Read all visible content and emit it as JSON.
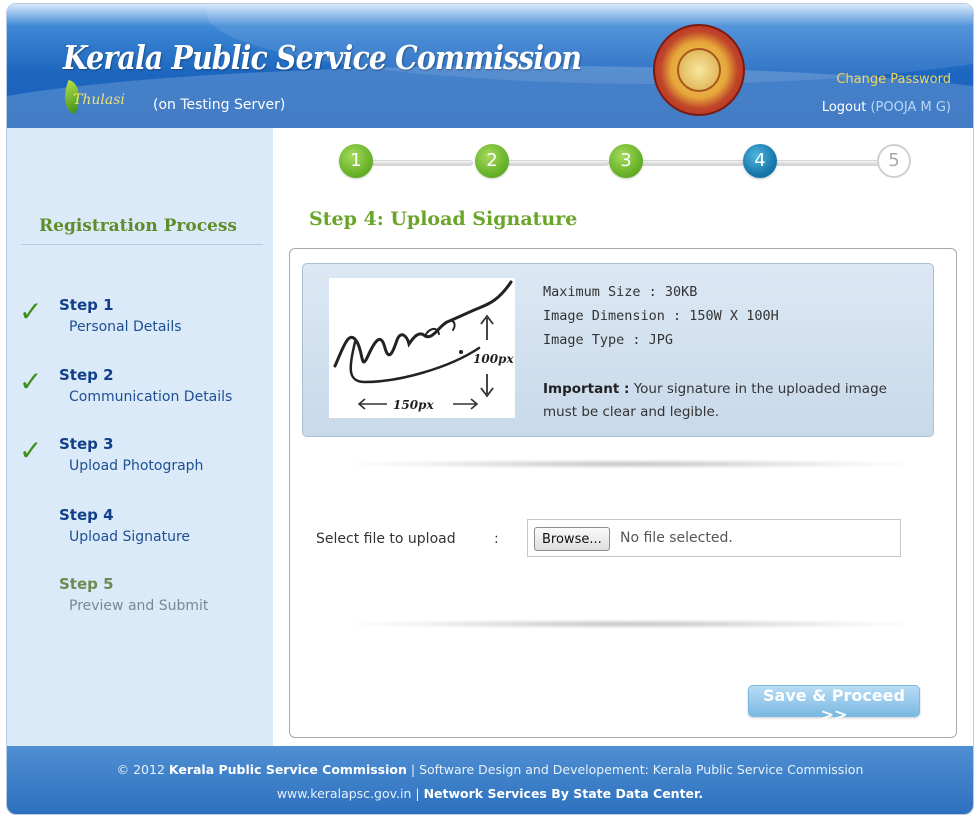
{
  "header": {
    "title": "Kerala Public Service Commission",
    "logo_word": "Thulasi",
    "server_note": "(on Testing Server)",
    "change_password": "Change Password",
    "logout_label": "Logout",
    "logout_user": "(POOJA M G)"
  },
  "sidebar": {
    "title": "Registration Process",
    "steps": [
      {
        "num": "Step 1",
        "desc": "Personal Details",
        "completed": true
      },
      {
        "num": "Step 2",
        "desc": "Communication Details",
        "completed": true
      },
      {
        "num": "Step 3",
        "desc": "Upload Photograph",
        "completed": true
      },
      {
        "num": "Step 4",
        "desc": "Upload Signature",
        "completed": false,
        "current": true
      },
      {
        "num": "Step 5",
        "desc": "Preview and Submit",
        "completed": false
      }
    ],
    "check_glyph": "✓"
  },
  "stepper": {
    "labels": [
      "1",
      "2",
      "3",
      "4",
      "5"
    ],
    "current": 4
  },
  "main": {
    "heading": "Step 4: Upload Signature",
    "sample": {
      "height_label": "100px",
      "width_label": "150px"
    },
    "info": {
      "max_size": "Maximum Size : 30KB",
      "dimension": "Image Dimension : 150W X 100H",
      "type": "Image Type : JPG",
      "important_label": "Important :",
      "important_text": " Your signature in the uploaded image must be clear and legible."
    },
    "upload": {
      "label": "Select file to upload",
      "colon": ":",
      "browse": "Browse...",
      "status": "No file selected."
    },
    "save_button": "Save & Proceed >>"
  },
  "footer": {
    "copyright": "© 2012 ",
    "org": "Kerala Public Service Commission",
    "credit": " | Software Design and Developement: Kerala Public Service Commission",
    "site": "www.keralapsc.gov.in",
    "sep": " | ",
    "network": "Network Services By State Data Center."
  },
  "colors": {
    "header_blue": "#1d67c0",
    "done_green": "#69b32a",
    "current_blue": "#1879ad",
    "heading_green": "#6aa528"
  }
}
